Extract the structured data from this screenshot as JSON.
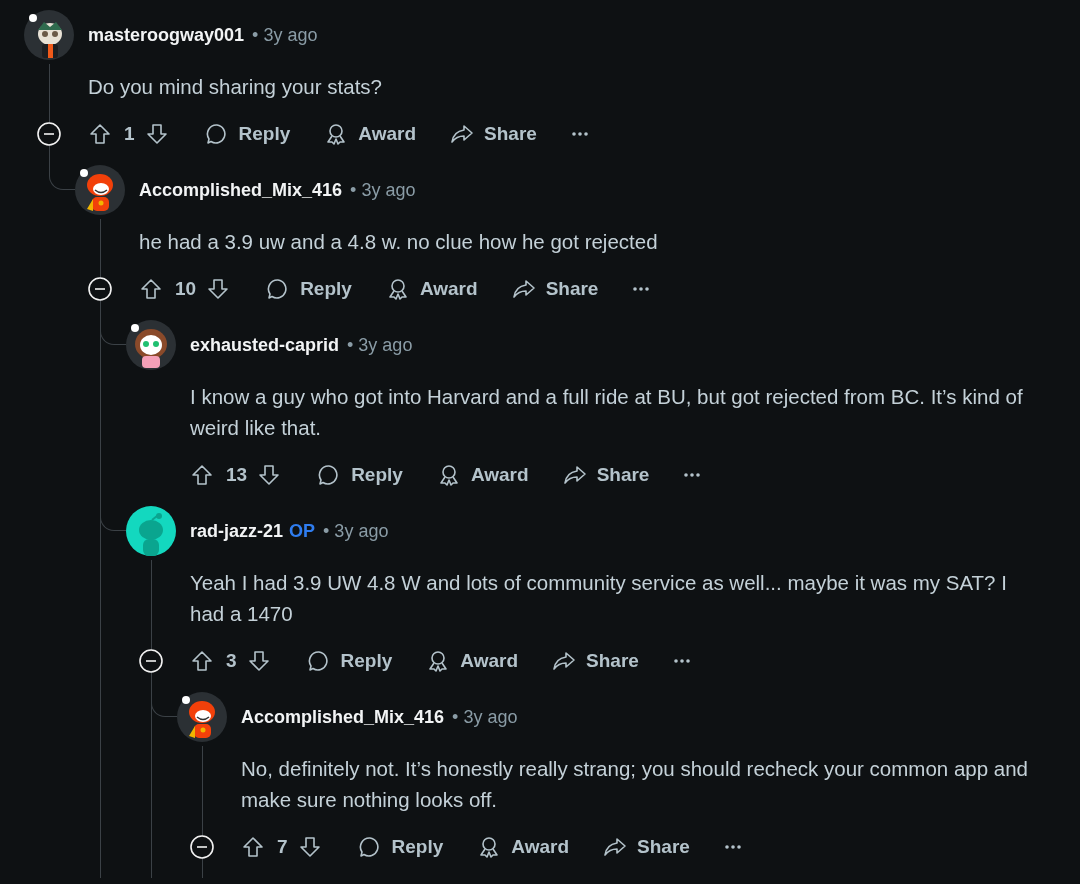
{
  "comments": [
    {
      "author": "masteroogway001",
      "time": "• 3y ago",
      "avatar": {
        "kind": "owl"
      },
      "body": "Do you mind sharing your stats?",
      "votes": "1",
      "expanded": true,
      "reply_label": "Reply",
      "award_label": "Award",
      "share_label": "Share",
      "children": [
        {
          "author": "Accomplished_Mix_416",
          "time": "• 3y ago",
          "avatar": {
            "kind": "snoo-red"
          },
          "body": "he had a 3.9 uw and a 4.8 w. no clue how he got rejected",
          "votes": "10",
          "expanded": true,
          "reply_label": "Reply",
          "award_label": "Award",
          "share_label": "Share",
          "children": [
            {
              "author": "exhausted-caprid",
              "time": "• 3y ago",
              "avatar": {
                "kind": "girl"
              },
              "body": "I know a guy who got into Harvard and a full ride at BU, but got rejected from BC. It’s kind of weird like that.",
              "votes": "13",
              "reply_label": "Reply",
              "award_label": "Award",
              "share_label": "Share"
            },
            {
              "author": "rad-jazz-21",
              "op": "OP",
              "time": "• 3y ago",
              "avatar": {
                "kind": "default"
              },
              "body": "Yeah I had 3.9 UW 4.8 W and lots of community service as well... maybe it was my SAT? I had a 1470",
              "votes": "3",
              "expanded": true,
              "reply_label": "Reply",
              "award_label": "Award",
              "share_label": "Share",
              "children": [
                {
                  "author": "Accomplished_Mix_416",
                  "time": "• 3y ago",
                  "avatar": {
                    "kind": "snoo-red"
                  },
                  "body": "No, definitely not. It’s honestly really strang; you should recheck your common app and make sure nothing looks off.",
                  "votes": "7",
                  "expanded": true,
                  "reply_label": "Reply",
                  "award_label": "Award",
                  "share_label": "Share"
                }
              ]
            }
          ]
        }
      ]
    }
  ]
}
